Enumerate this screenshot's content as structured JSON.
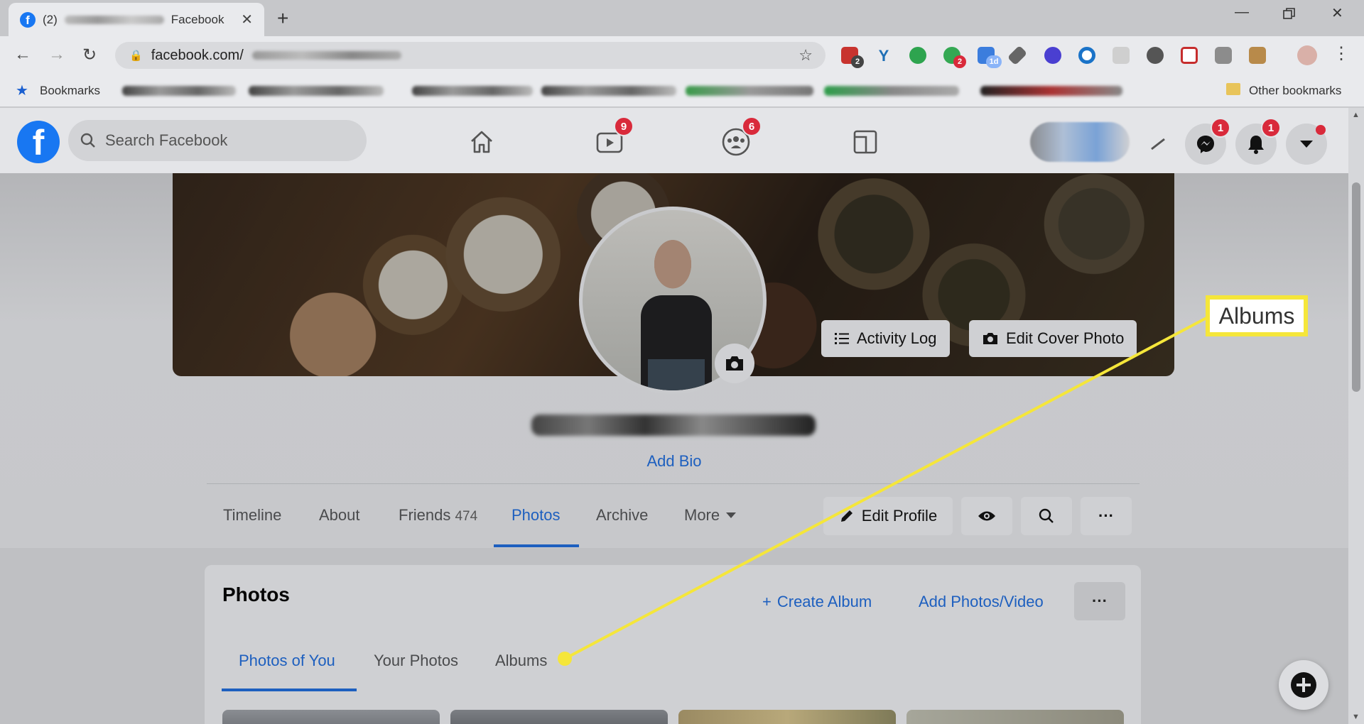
{
  "browser": {
    "tab_count": "(2)",
    "tab_title": "Facebook",
    "url": "facebook.com/",
    "bookmarks_label": "Bookmarks",
    "other_bookmarks": "Other bookmarks",
    "extension_badges": [
      "2",
      "2",
      "1d"
    ]
  },
  "fb": {
    "search_placeholder": "Search Facebook",
    "watch_badge": "9",
    "groups_badge": "6",
    "messenger_badge": "1",
    "notifications_badge": "1"
  },
  "profile": {
    "activity_log": "Activity Log",
    "edit_cover": "Edit Cover Photo",
    "add_bio": "Add Bio",
    "tabs": {
      "timeline": "Timeline",
      "about": "About",
      "friends": "Friends",
      "friends_count": "474",
      "photos": "Photos",
      "archive": "Archive",
      "more": "More"
    },
    "edit_profile": "Edit Profile"
  },
  "photos": {
    "title": "Photos",
    "create_album": "Create Album",
    "add_photos": "Add Photos/Video",
    "subtabs": {
      "photos_of_you": "Photos of You",
      "your_photos": "Your Photos",
      "albums": "Albums"
    }
  },
  "callout": {
    "label": "Albums",
    "color": "#f5e63a"
  },
  "colors": {
    "fb_blue": "#1877f2",
    "link_blue": "#1d5fbf",
    "badge_red": "#d92a3b"
  }
}
